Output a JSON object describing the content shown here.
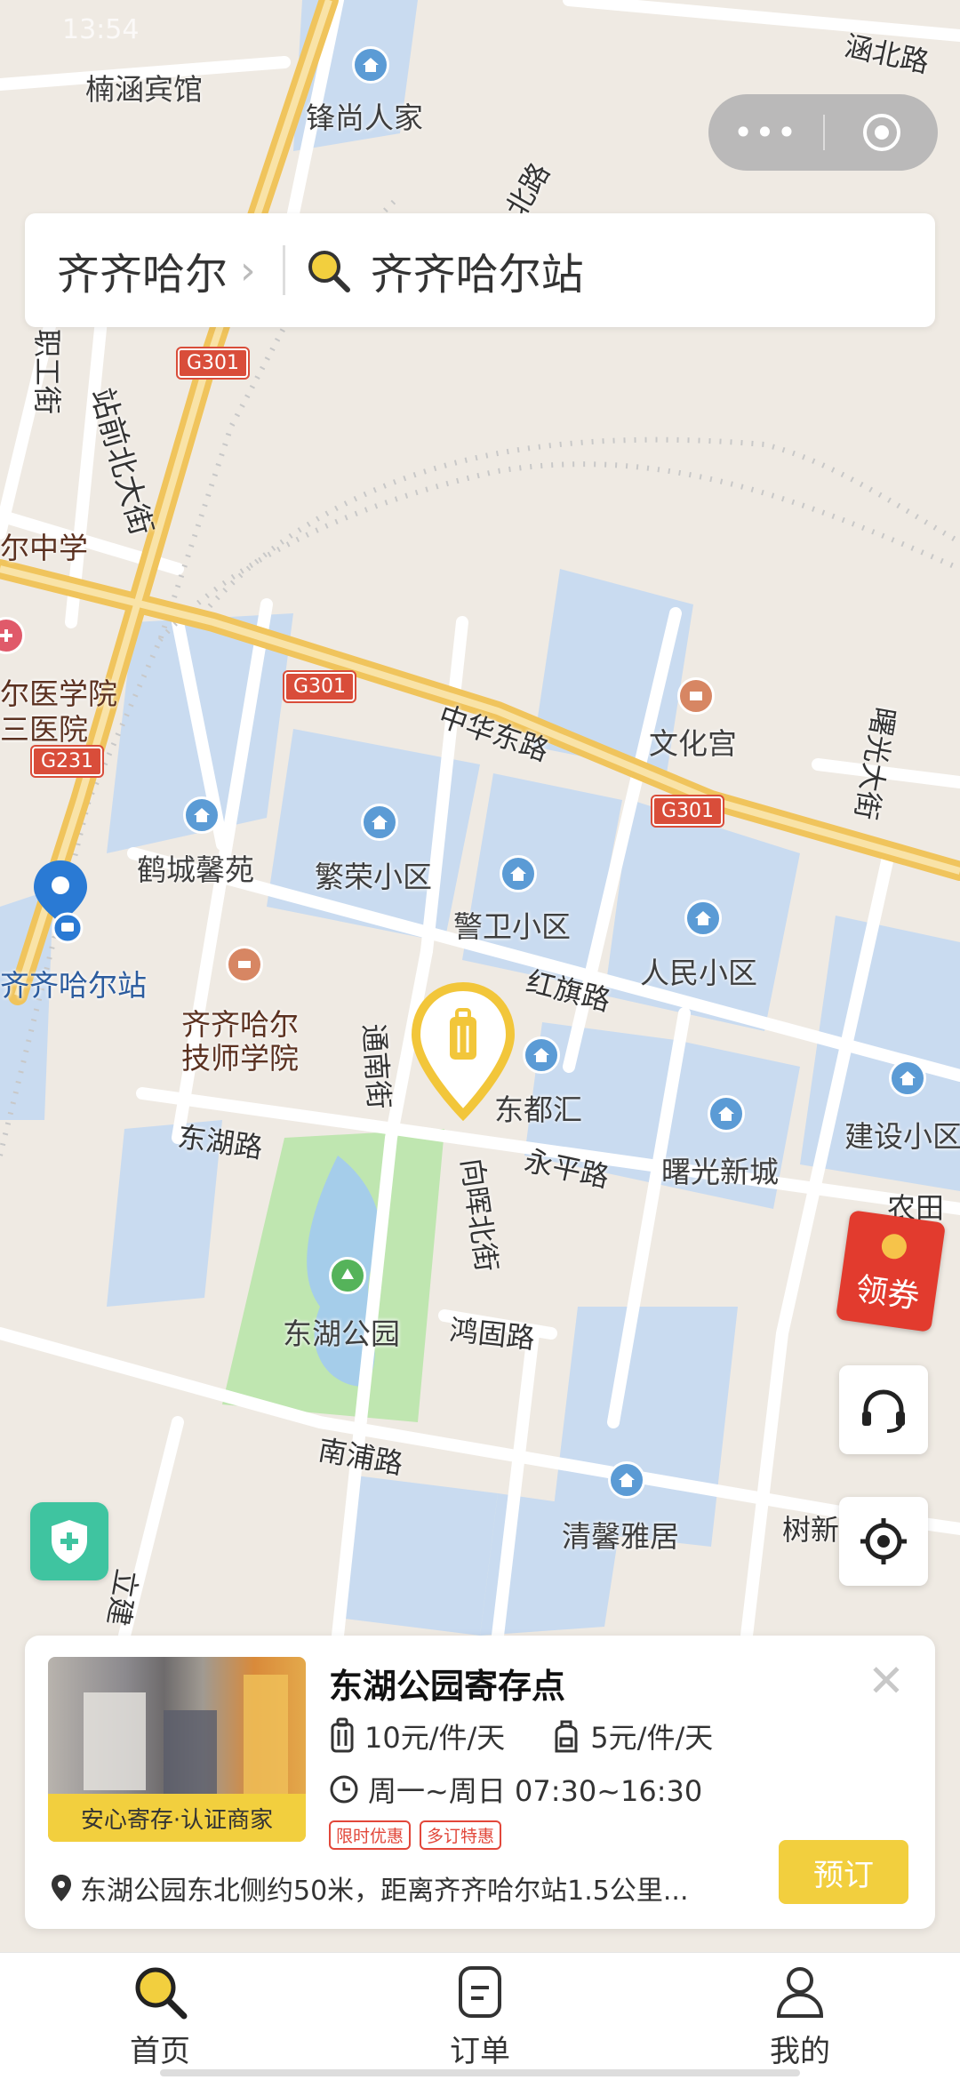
{
  "status": {
    "time": "13:54"
  },
  "capsule": {
    "more_icon": "more-dots-icon",
    "close_icon": "target-circle-icon"
  },
  "search": {
    "city": "齐齐哈尔",
    "query": "齐齐哈尔站"
  },
  "map": {
    "roads": {
      "zhongqian_beidajie": "站前北大街",
      "zhigong_jie": "职工街",
      "zhonghua_donglu": "中华东路",
      "hongqi_lu": "红旗路",
      "tongnan_jie": "通南街",
      "donghu_lu": "东湖路",
      "yongping_lu": "永平路",
      "xianghui_beijie": "向晖北街",
      "honggu_lu": "鸿固路",
      "nanpu_lu": "南浦路",
      "shuguang_dajie": "曙光大街",
      "shuxin": "树新",
      "li_jian": "立建",
      "nongtian": "农田",
      "bei_lu": "涵北路",
      "bei_2": "北路"
    },
    "shields": [
      "G301",
      "G301",
      "G231",
      "G301"
    ],
    "pois": {
      "nanhan_hotel": "楠涵宾馆",
      "fengshang": "锋尚人家",
      "zhongxue": "尔中学",
      "yixueyuan": "尔医学院",
      "sanyiyuan": "三医院",
      "wenhuagong": "文化宫",
      "hecheng": "鹤城馨苑",
      "fanrong": "繁荣小区",
      "jingwei": "警卫小区",
      "renmin": "人民小区",
      "station": "齐齐哈尔站",
      "jishi_1": "齐齐哈尔",
      "jishi_2": "技师学院",
      "dongduhui": "东都汇",
      "shuguang_xincheng": "曙光新城",
      "jianshe": "建设小区",
      "donghu_park": "东湖公园",
      "qingxin": "清馨雅居"
    }
  },
  "widgets": {
    "coupon_label": "领券"
  },
  "card": {
    "name": "东湖公园寄存点",
    "badge": "安心寄存·认证商家",
    "price_large": "10元/件/天",
    "price_small": "5元/件/天",
    "hours": "周一~周日 07:30~16:30",
    "tags": [
      "限时优惠",
      "多订特惠"
    ],
    "address": "东湖公园东北侧约50米，距离齐齐哈尔站1.5公里...",
    "book_label": "预订"
  },
  "tabs": [
    {
      "label": "首页",
      "icon": "search-icon"
    },
    {
      "label": "订单",
      "icon": "order-icon"
    },
    {
      "label": "我的",
      "icon": "user-icon"
    }
  ],
  "colors": {
    "accent": "#f2cf3e",
    "coupon": "#e23b2e",
    "shield": "#3fc4a0",
    "route": "#f0c45c"
  }
}
